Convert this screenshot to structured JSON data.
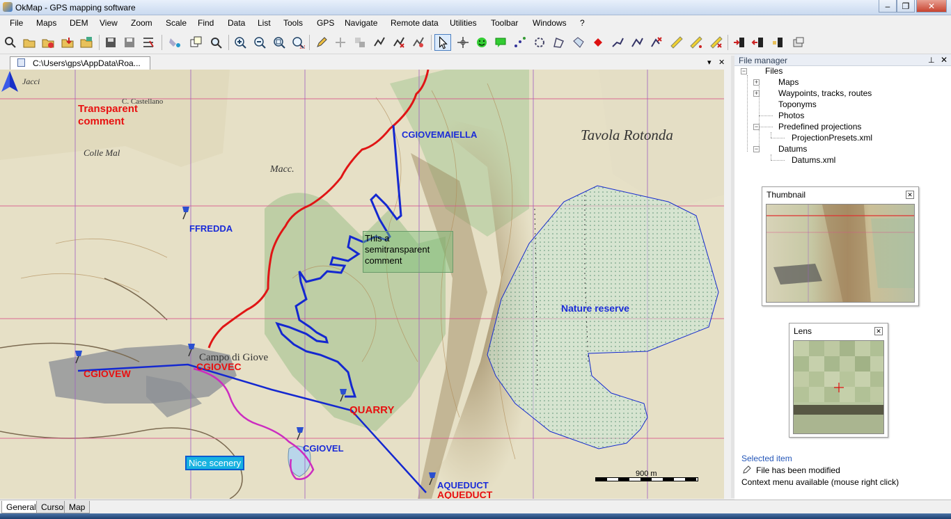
{
  "window": {
    "title": "OkMap - GPS mapping software",
    "minimize_glyph": "‒",
    "maximize_glyph": "❐",
    "close_glyph": "✕"
  },
  "menu": [
    "File",
    "Maps",
    "DEM",
    "View",
    "Zoom",
    "Scale",
    "Find",
    "Data",
    "List",
    "Tools",
    "GPS",
    "Navigate",
    "Remote data",
    "Utilities",
    "Toolbar",
    "Windows",
    "?"
  ],
  "toolbar": {
    "icons": [
      "gps-route-icon",
      "open-folder-icon",
      "open-track-icon",
      "import-icon",
      "export-icon",
      "save-icon",
      "save-all-icon",
      "settings-icon",
      "color-fill-icon",
      "layers-icon",
      "find-icon",
      "zoom-in-icon",
      "zoom-out-icon",
      "zoom-area-icon",
      "zoom-1to1-icon",
      "edit-pen-icon",
      "add-point-icon",
      "merge-icon",
      "select-track-icon",
      "select-route-icon",
      "tools-icon",
      "cursor-icon",
      "pan-icon",
      "smile-icon",
      "comment-icon",
      "waypoint-dots-icon",
      "circle-icon",
      "polygon-icon",
      "area-edit-icon",
      "red-diamond-icon",
      "draw-line-icon",
      "route-edit-icon",
      "route-delete-icon",
      "ruler-icon",
      "measure-icon",
      "measure-delete-icon",
      "upload-icon",
      "download-icon",
      "gps-device-icon",
      "gps-settings-icon"
    ]
  },
  "document": {
    "tab_label": "C:\\Users\\gps\\AppData\\Roa...",
    "dropdown_glyph": "▾",
    "close_glyph": "✕"
  },
  "map": {
    "labels": [
      {
        "id": "transparent",
        "text": "Transparent",
        "color": "red"
      },
      {
        "id": "comment",
        "text": "comment",
        "color": "red"
      },
      {
        "id": "cgiovemaiella",
        "text": "CGIOVEMAIELLA",
        "color": "blue"
      },
      {
        "id": "ffredda",
        "text": "FFREDDA",
        "color": "blue"
      },
      {
        "id": "cgiovew",
        "text": "CGIOVEW",
        "color": "red"
      },
      {
        "id": "cgiovec",
        "text": "CGIOVEC",
        "color": "red"
      },
      {
        "id": "quarry",
        "text": "QUARRY",
        "color": "red"
      },
      {
        "id": "cgiovel",
        "text": "CGIOVEL",
        "color": "blue"
      },
      {
        "id": "aqueduct-blue",
        "text": "AQUEDUCT",
        "color": "blue"
      },
      {
        "id": "aqueduct-red",
        "text": "AQUEDUCT",
        "color": "red"
      },
      {
        "id": "nature",
        "text": "Nature reserve",
        "color": "blue"
      }
    ],
    "place_names": {
      "tavola": "Tavola Rotonda",
      "campo": "Campo di Giove",
      "castellano": "C. Castellano",
      "colle": "Colle Mal",
      "macc": "Macc.",
      "jaccio": "Jacci"
    },
    "semi_comment": "This a semitransparent comment",
    "nice_scenery": "Nice scenery",
    "scale_label": "900 m"
  },
  "file_manager": {
    "title": "File manager",
    "pin_glyph": "⊥",
    "close_glyph": "✕",
    "tree": {
      "root": "Files",
      "maps": "Maps",
      "waypoints": "Waypoints, tracks, routes",
      "toponyms": "Toponyms",
      "photos": "Photos",
      "projections": "Predefined projections",
      "projections_file": "ProjectionPresets.xml",
      "datums": "Datums",
      "datums_file": "Datums.xml"
    }
  },
  "thumbnail": {
    "title": "Thumbnail",
    "close_glyph": "✕"
  },
  "lens": {
    "title": "Lens",
    "close_glyph": "✕"
  },
  "selected": {
    "heading": "Selected item",
    "modified": "File has been modified",
    "context": "Context menu available (mouse right click)"
  },
  "bottom_tabs": [
    "General",
    "Cursor",
    "Map"
  ],
  "colors": {
    "track_red": "#e01515",
    "track_blue": "#1428d0",
    "track_magenta": "#cc2cc0",
    "grid_red": "#d9558a",
    "grid_purple": "#a060c0"
  }
}
